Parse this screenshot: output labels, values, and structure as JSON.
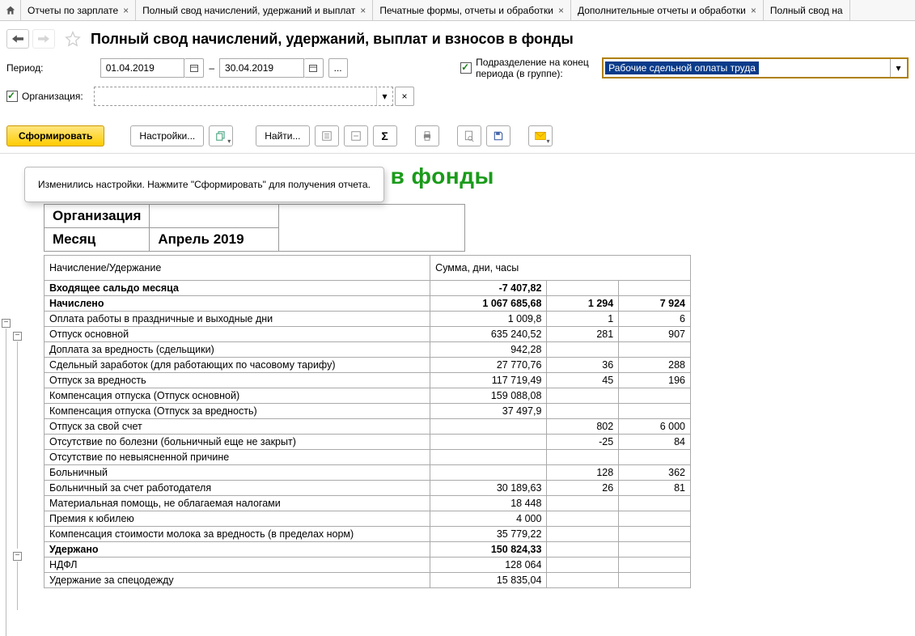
{
  "tabs": [
    {
      "label": "Отчеты по зарплате"
    },
    {
      "label": "Полный свод начислений, удержаний и выплат"
    },
    {
      "label": "Печатные формы, отчеты и обработки"
    },
    {
      "label": "Дополнительные отчеты и обработки"
    },
    {
      "label": "Полный свод на"
    }
  ],
  "header": {
    "title": "Полный свод начислений, удержаний, выплат и взносов в фонды"
  },
  "filters": {
    "period_label": "Период:",
    "date_from": "01.04.2019",
    "date_to": "30.04.2019",
    "ellipsis": "...",
    "unit_checkbox_label": "Подразделение на конец периода (в группе):",
    "unit_value": "Рабочие сдельной оплаты труда",
    "org_checkbox_label": "Организация:"
  },
  "toolbar": {
    "generate": "Сформировать",
    "settings": "Настройки...",
    "find": "Найти..."
  },
  "tooltip": "Изменились настройки. Нажмите \"Сформировать\" для получения отчета.",
  "report": {
    "title_prefix": "держаний, выплат и взносов в фонды",
    "meta": {
      "org_label": "Организация",
      "month_label": "Месяц",
      "month_value": "Апрель 2019"
    },
    "columns": {
      "c0": "Начисление/Удержание",
      "c1": "Сумма, дни, часы"
    },
    "rows": [
      {
        "bold": true,
        "c0": "Входящее сальдо месяца",
        "c1": "-7 407,82",
        "c2": "",
        "c3": ""
      },
      {
        "bold": true,
        "c0": "Начислено",
        "c1": "1 067 685,68",
        "c2": "1 294",
        "c3": "7 924"
      },
      {
        "bold": false,
        "c0": "Оплата работы в праздничные и выходные дни",
        "c1": "1 009,8",
        "c2": "1",
        "c3": "6"
      },
      {
        "bold": false,
        "c0": "Отпуск основной",
        "c1": "635 240,52",
        "c2": "281",
        "c3": "907"
      },
      {
        "bold": false,
        "c0": "Доплата за вредность (сдельщики)",
        "c1": "942,28",
        "c2": "",
        "c3": ""
      },
      {
        "bold": false,
        "c0": "Сдельный заработок (для работающих по часовому тарифу)",
        "c1": "27 770,76",
        "c2": "36",
        "c3": "288"
      },
      {
        "bold": false,
        "c0": "Отпуск за вредность",
        "c1": "117 719,49",
        "c2": "45",
        "c3": "196"
      },
      {
        "bold": false,
        "c0": "Компенсация отпуска (Отпуск основной)",
        "c1": "159 088,08",
        "c2": "",
        "c3": ""
      },
      {
        "bold": false,
        "c0": "Компенсация отпуска (Отпуск за вредность)",
        "c1": "37 497,9",
        "c2": "",
        "c3": ""
      },
      {
        "bold": false,
        "c0": "Отпуск за свой счет",
        "c1": "",
        "c2": "802",
        "c3": "6 000"
      },
      {
        "bold": false,
        "c0": "Отсутствие по болезни (больничный еще не закрыт)",
        "c1": "",
        "c2": "-25",
        "c3": "84"
      },
      {
        "bold": false,
        "c0": "Отсутствие по невыясненной причине",
        "c1": "",
        "c2": "",
        "c3": ""
      },
      {
        "bold": false,
        "c0": "Больничный",
        "c1": "",
        "c2": "128",
        "c3": "362"
      },
      {
        "bold": false,
        "c0": "Больничный за счет работодателя",
        "c1": "30 189,63",
        "c2": "26",
        "c3": "81"
      },
      {
        "bold": false,
        "c0": "Материальная помощь, не облагаемая налогами",
        "c1": "18 448",
        "c2": "",
        "c3": ""
      },
      {
        "bold": false,
        "c0": "Премия к юбилею",
        "c1": "4 000",
        "c2": "",
        "c3": ""
      },
      {
        "bold": false,
        "c0": "Компенсация стоимости молока за вредность (в пределах норм)",
        "c1": "35 779,22",
        "c2": "",
        "c3": ""
      },
      {
        "bold": true,
        "c0": "Удержано",
        "c1": "150 824,33",
        "c2": "",
        "c3": ""
      },
      {
        "bold": false,
        "c0": "НДФЛ",
        "c1": "128 064",
        "c2": "",
        "c3": ""
      },
      {
        "bold": false,
        "c0": "Удержание за спецодежду",
        "c1": "15 835,04",
        "c2": "",
        "c3": ""
      }
    ]
  }
}
